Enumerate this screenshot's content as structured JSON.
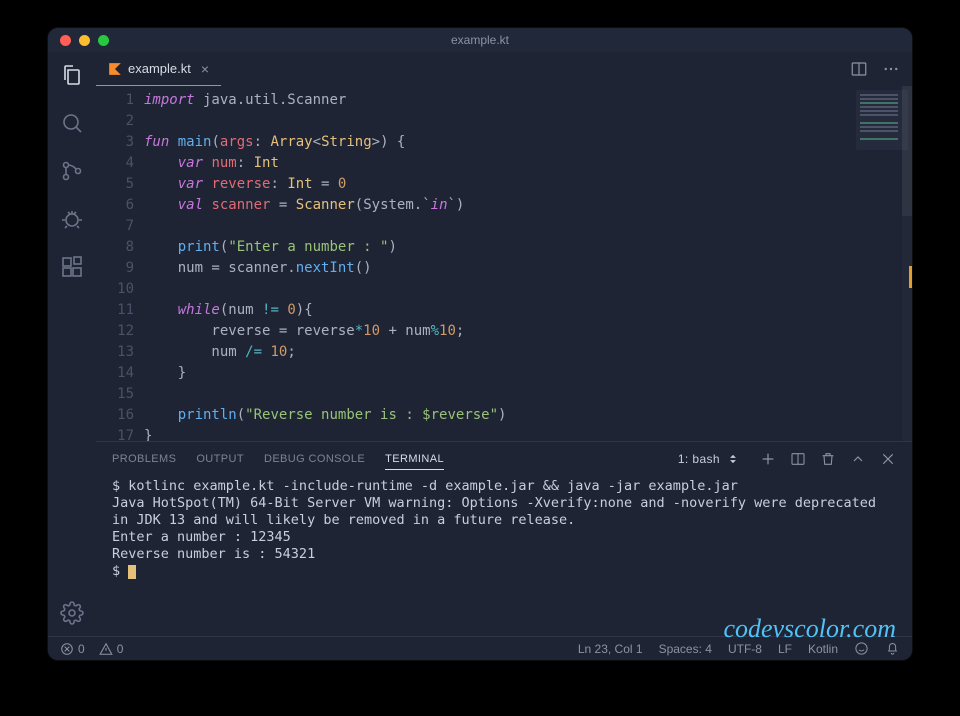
{
  "window": {
    "title": "example.kt"
  },
  "tab": {
    "filename": "example.kt"
  },
  "code": {
    "lines": [
      [
        [
          "kw",
          "import"
        ],
        [
          "pn",
          " java.util.Scanner"
        ]
      ],
      [],
      [
        [
          "kw",
          "fun"
        ],
        [
          "pn",
          " "
        ],
        [
          "fn",
          "main"
        ],
        [
          "pn",
          "("
        ],
        [
          "var",
          "args"
        ],
        [
          "pn",
          ": "
        ],
        [
          "type",
          "Array"
        ],
        [
          "pn",
          "<"
        ],
        [
          "type",
          "String"
        ],
        [
          "pn",
          ">) {"
        ]
      ],
      [
        [
          "pn",
          "    "
        ],
        [
          "kw",
          "var"
        ],
        [
          "pn",
          " "
        ],
        [
          "var",
          "num"
        ],
        [
          "pn",
          ": "
        ],
        [
          "type",
          "Int"
        ]
      ],
      [
        [
          "pn",
          "    "
        ],
        [
          "kw",
          "var"
        ],
        [
          "pn",
          " "
        ],
        [
          "var",
          "reverse"
        ],
        [
          "pn",
          ": "
        ],
        [
          "type",
          "Int"
        ],
        [
          "pn",
          " = "
        ],
        [
          "num",
          "0"
        ]
      ],
      [
        [
          "pn",
          "    "
        ],
        [
          "kw",
          "val"
        ],
        [
          "pn",
          " "
        ],
        [
          "var",
          "scanner"
        ],
        [
          "pn",
          " = "
        ],
        [
          "type",
          "Scanner"
        ],
        [
          "pn",
          "(System.`"
        ],
        [
          "kw",
          "in"
        ],
        [
          "pn",
          "`)"
        ]
      ],
      [],
      [
        [
          "pn",
          "    "
        ],
        [
          "fn",
          "print"
        ],
        [
          "pn",
          "("
        ],
        [
          "str",
          "\"Enter a number : \""
        ],
        [
          "pn",
          ")"
        ]
      ],
      [
        [
          "pn",
          "    num = scanner."
        ],
        [
          "fn",
          "nextInt"
        ],
        [
          "pn",
          "()"
        ]
      ],
      [],
      [
        [
          "pn",
          "    "
        ],
        [
          "kw",
          "while"
        ],
        [
          "pn",
          "(num "
        ],
        [
          "op",
          "!="
        ],
        [
          "pn",
          " "
        ],
        [
          "num",
          "0"
        ],
        [
          "pn",
          "){"
        ]
      ],
      [
        [
          "pn",
          "        reverse = reverse"
        ],
        [
          "op",
          "*"
        ],
        [
          "num",
          "10"
        ],
        [
          "pn",
          " + num"
        ],
        [
          "op",
          "%"
        ],
        [
          "num",
          "10"
        ],
        [
          "pn",
          ";"
        ]
      ],
      [
        [
          "pn",
          "        num "
        ],
        [
          "op",
          "/="
        ],
        [
          "pn",
          " "
        ],
        [
          "num",
          "10"
        ],
        [
          "pn",
          ";"
        ]
      ],
      [
        [
          "pn",
          "    }"
        ]
      ],
      [],
      [
        [
          "pn",
          "    "
        ],
        [
          "fn",
          "println"
        ],
        [
          "pn",
          "("
        ],
        [
          "str",
          "\"Reverse number is : $reverse\""
        ],
        [
          "pn",
          ")"
        ]
      ],
      [
        [
          "pn",
          "}"
        ]
      ]
    ]
  },
  "panel": {
    "tabs": {
      "problems": "PROBLEMS",
      "output": "OUTPUT",
      "debug": "DEBUG CONSOLE",
      "terminal": "TERMINAL"
    },
    "shell": "1: bash",
    "terminal_lines": [
      "$ kotlinc example.kt -include-runtime -d example.jar && java -jar example.jar",
      "Java HotSpot(TM) 64-Bit Server VM warning: Options -Xverify:none and -noverify were deprecated in JDK 13 and will likely be removed in a future release.",
      "Enter a number : 12345",
      "Reverse number is : 54321",
      "$ "
    ]
  },
  "status": {
    "errors": "0",
    "warnings": "0",
    "cursor": "Ln 23, Col 1",
    "spaces": "Spaces: 4",
    "encoding": "UTF-8",
    "eol": "LF",
    "lang": "Kotlin"
  },
  "watermark": "codevscolor.com"
}
